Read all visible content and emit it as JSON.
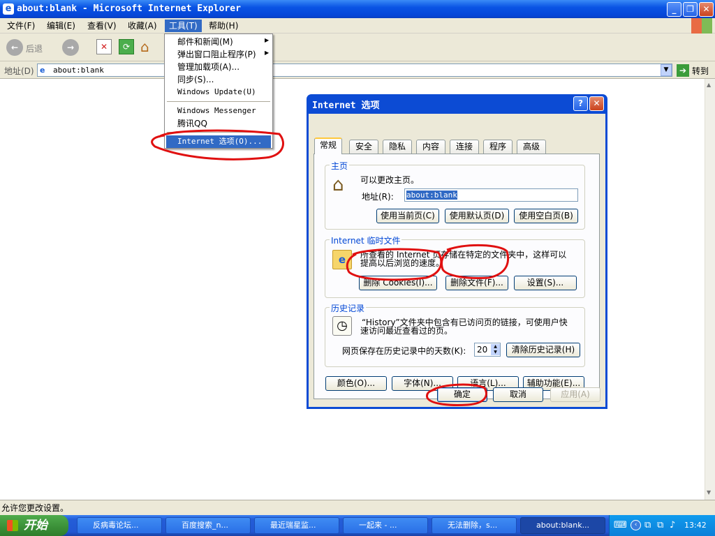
{
  "window": {
    "title": "about:blank - Microsoft Internet Explorer"
  },
  "menubar": {
    "items": [
      "文件(F)",
      "编辑(E)",
      "查看(V)",
      "收藏(A)",
      "工具(T)",
      "帮助(H)"
    ]
  },
  "toolbar": {
    "back_label": "后退",
    "go_label": "转到"
  },
  "address": {
    "label": "地址(D)",
    "value": "about:blank"
  },
  "tools_menu": {
    "items": [
      "邮件和新闻(M)",
      "弹出窗口阻止程序(P)",
      "管理加载项(A)...",
      "同步(S)...",
      "Windows Update(U)",
      "Windows Messenger",
      "腾讯QQ",
      "Internet 选项(O)..."
    ]
  },
  "dialog": {
    "title": "Internet 选项",
    "tabs": [
      "常规",
      "安全",
      "隐私",
      "内容",
      "连接",
      "程序",
      "高级"
    ],
    "home": {
      "legend": "主页",
      "desc": "可以更改主页。",
      "address_label": "地址(R):",
      "address_value": "about:blank",
      "btn_current": "使用当前页(C)",
      "btn_default": "使用默认页(D)",
      "btn_blank": "使用空白页(B)"
    },
    "temp": {
      "legend": "Internet 临时文件",
      "desc1": "所查看的 Internet 页存储在特定的文件夹中，这样可以",
      "desc2": "提高以后浏览的速度。",
      "btn_cookies": "删除 Cookies(I)...",
      "btn_files": "删除文件(F)...",
      "btn_settings": "设置(S)..."
    },
    "history": {
      "legend": "历史记录",
      "desc1": "“History”文件夹中包含有已访问页的链接，可使用户快",
      "desc2": "速访问最近查看过的页。",
      "days_label": "网页保存在历史记录中的天数(K):",
      "days_value": "20",
      "btn_clear": "清除历史记录(H)"
    },
    "bottom_buttons": [
      "颜色(O)...",
      "字体(N)...",
      "语言(L)...",
      "辅助功能(E)..."
    ],
    "ok": "确定",
    "cancel": "取消",
    "apply": "应用(A)"
  },
  "status": {
    "text": "允许您更改设置。"
  },
  "taskbar": {
    "start": "开始",
    "tasks": [
      "反病毒论坛...",
      "百度搜索_n...",
      "最近瑞星监...",
      "一起来 - ...",
      "无法删除，s...",
      "about:blank..."
    ],
    "clock": "13:42"
  }
}
